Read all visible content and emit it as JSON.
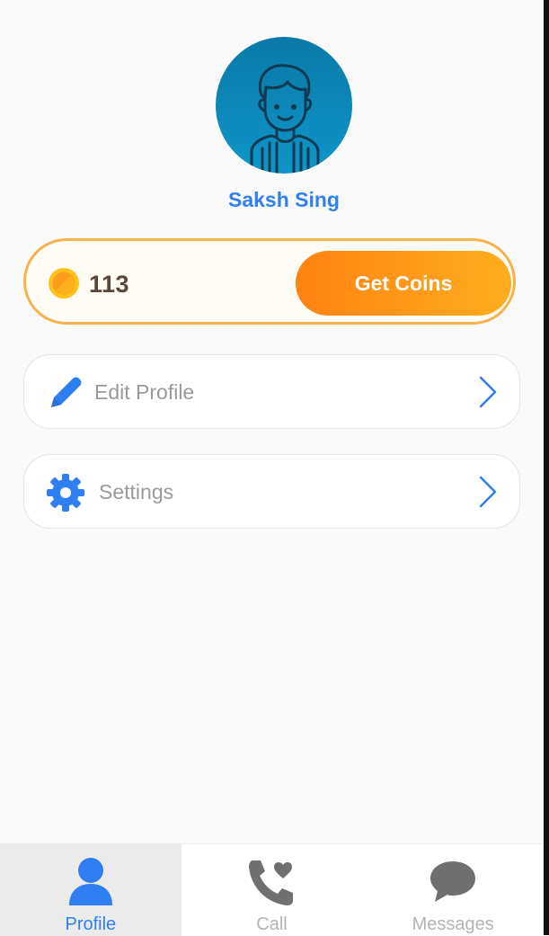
{
  "profile": {
    "name": "Saksh Sing",
    "avatar_icon": "user-avatar-icon"
  },
  "coins": {
    "icon": "coin-icon",
    "count": "113",
    "button_label": "Get Coins"
  },
  "menu": [
    {
      "label": "Edit Profile",
      "icon": "pencil-icon"
    },
    {
      "label": "Settings",
      "icon": "gear-icon"
    }
  ],
  "tabs": [
    {
      "label": "Profile",
      "icon": "person-icon",
      "active": true
    },
    {
      "label": "Call",
      "icon": "phone-heart-icon",
      "active": false
    },
    {
      "label": "Messages",
      "icon": "chat-bubble-icon",
      "active": false
    }
  ],
  "colors": {
    "accent_blue": "#2f7ff2",
    "coin_orange_start": "#ff8212",
    "coin_orange_end": "#ffad1f",
    "coin_border": "#f7b24c",
    "avatar_bg": "#0e95c8"
  }
}
